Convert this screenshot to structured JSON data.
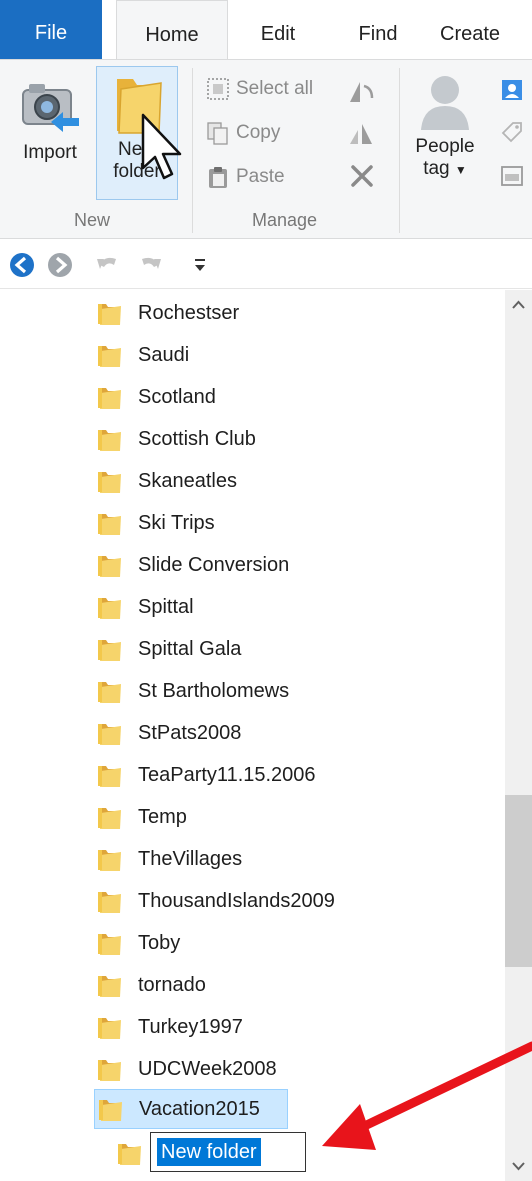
{
  "ribbon_tabs": {
    "file": "File",
    "home": "Home",
    "edit": "Edit",
    "find": "Find",
    "create": "Create"
  },
  "ribbon": {
    "import_label": "Import",
    "new_folder_label_line1": "New",
    "new_folder_label_line2": "folder",
    "group_new": "New",
    "select_all": "Select all",
    "copy": "Copy",
    "paste": "Paste",
    "group_manage": "Manage",
    "people_tag_line1": "People",
    "people_tag_line2": "tag"
  },
  "quick_access": {
    "icons": [
      "back-icon",
      "forward-icon",
      "undo-icon",
      "redo-icon",
      "customize-dropdown-icon"
    ]
  },
  "folders": [
    "Rochestser",
    "Saudi",
    "Scotland",
    "Scottish Club",
    "Skaneatles",
    "Ski Trips",
    "Slide Conversion",
    "Spittal",
    "Spittal Gala",
    "St Bartholomews",
    "StPats2008",
    "TeaParty11.15.2006",
    "Temp",
    "TheVillages",
    "ThousandIslands2009",
    "Toby",
    "tornado",
    "Turkey1997",
    "UDCWeek2008",
    "Vacation2015"
  ],
  "selected_folder": "Vacation2015",
  "new_folder_edit_value": "New folder",
  "colors": {
    "file_tab": "#1b6ec2",
    "selection": "#cce8ff",
    "text_selection": "#0078d7",
    "annotation_arrow": "#e8141b",
    "folder_yellow": "#f3c84b"
  }
}
